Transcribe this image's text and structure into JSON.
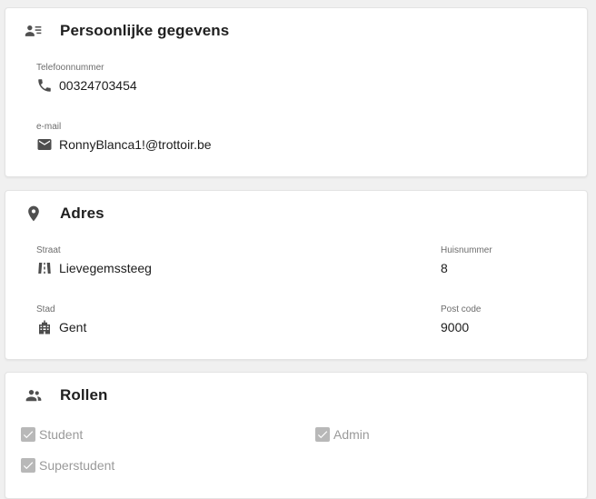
{
  "personal": {
    "title": "Persoonlijke gegevens",
    "icon": "contact-details-icon",
    "phone": {
      "label": "Telefoonnummer",
      "value": "00324703454",
      "icon": "phone-icon"
    },
    "email": {
      "label": "e-mail",
      "value": "RonnyBlanca1!@trottoir.be",
      "icon": "mail-icon"
    }
  },
  "address": {
    "title": "Adres",
    "icon": "location-pin-icon",
    "street": {
      "label": "Straat",
      "value": "Lievegemssteeg",
      "icon": "road-icon"
    },
    "house_number": {
      "label": "Huisnummer",
      "value": "8"
    },
    "city": {
      "label": "Stad",
      "value": "Gent",
      "icon": "city-building-icon"
    },
    "postcode": {
      "label": "Post code",
      "value": "9000"
    }
  },
  "roles": {
    "title": "Rollen",
    "icon": "people-icon",
    "items": [
      {
        "label": "Student",
        "checked": true
      },
      {
        "label": "Admin",
        "checked": true
      },
      {
        "label": "Superstudent",
        "checked": true
      }
    ]
  },
  "colors": {
    "page_background": "#f0f0f0",
    "card_background": "#ffffff",
    "checkbox_disabled": "#b8b8b8",
    "disabled_text": "#9a9a9a"
  }
}
